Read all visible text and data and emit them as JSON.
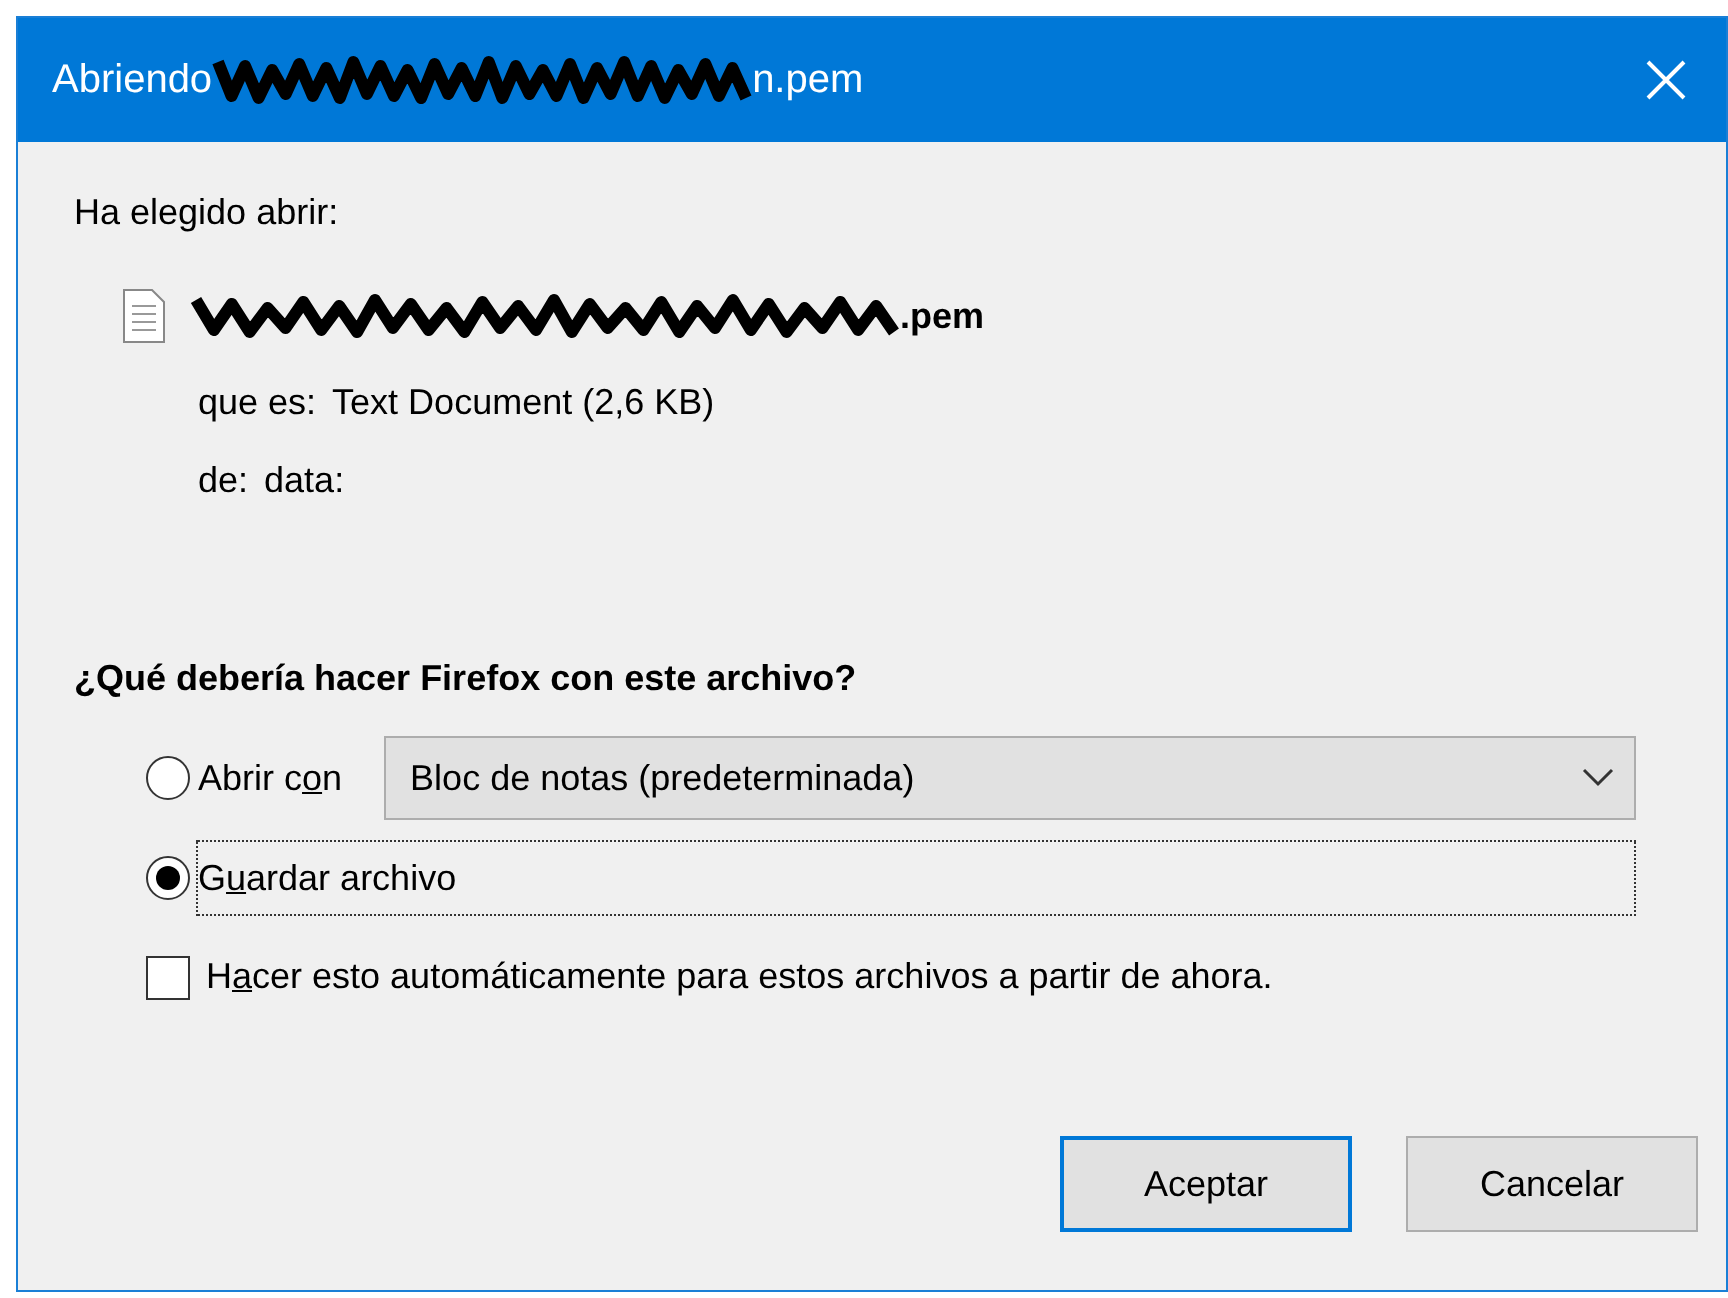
{
  "window": {
    "title_start": "Abriendo",
    "title_end": "n.pem"
  },
  "intro": "Ha elegido abrir:",
  "file": {
    "name_end": ".pem",
    "type_label": "que es:",
    "type_value": "Text Document (2,6 KB)",
    "from_label": "de:",
    "from_value": "data:"
  },
  "question": "¿Qué debería hacer Firefox con este archivo?",
  "options": [
    {
      "kind": "open-with",
      "label_parts": [
        "Abrir c",
        "o",
        "n"
      ],
      "selected": false,
      "focused": false,
      "app": "Bloc de notas (predeterminada)"
    },
    {
      "kind": "save",
      "label_parts": [
        "G",
        "u",
        "ardar archivo"
      ],
      "selected": true,
      "focused": true
    }
  ],
  "auto": {
    "label_parts": [
      "H",
      "a",
      "cer esto automáticamente para estos archivos a partir de ahora."
    ],
    "checked": false
  },
  "buttons": [
    {
      "label": "Aceptar",
      "default": true
    },
    {
      "label": "Cancelar",
      "default": false
    }
  ]
}
